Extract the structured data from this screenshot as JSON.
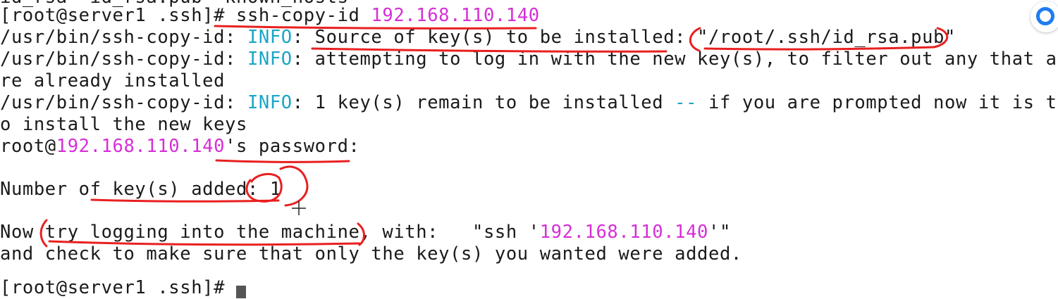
{
  "terminal": {
    "line0": {
      "text": "id_rsa  id_rsa.pub  known_hosts"
    },
    "line1": {
      "prompt": "[root@server1 .ssh]# ",
      "command": "ssh-copy-id ",
      "ip": "192.168.110.140"
    },
    "line2": {
      "prefix": "/usr/bin/ssh-copy-id: ",
      "info": "INFO",
      "msg": ": Source of key(s) to be installed: \"/root/.ssh/id_rsa.pub\""
    },
    "line3": {
      "prefix": "/usr/bin/ssh-copy-id: ",
      "info": "INFO",
      "msg": ": attempting to log in with the new key(s), to filter out any that a"
    },
    "line4": {
      "text": "re already installed"
    },
    "line5": {
      "prefix": "/usr/bin/ssh-copy-id: ",
      "info": "INFO",
      "msg_a": ": 1 key(s) remain to be installed ",
      "dashes": "--",
      "msg_b": " if you are prompted now it is t"
    },
    "line6": {
      "text": "o install the new keys"
    },
    "line7": {
      "user": "root@",
      "ip": "192.168.110.140",
      "rest": "'s password:"
    },
    "line9": {
      "text": "Number of key(s) added: 1"
    },
    "line11": {
      "a": "Now try logging into the machine, with:   \"ssh '",
      "ip": "192.168.110.140",
      "b": "'\""
    },
    "line12": {
      "text": "and check to make sure that only the key(s) you wanted were added."
    },
    "line13": {
      "prompt": "[root@server1 .ssh]# "
    }
  },
  "colors": {
    "accent_magenta": "#d62fd6",
    "info_cyan": "#1aa6c6",
    "annotation_red": "#e8201f"
  },
  "icons": {
    "floating_button": "assistant-ring-icon",
    "mouse_cursor": "crosshair-cursor-icon"
  }
}
